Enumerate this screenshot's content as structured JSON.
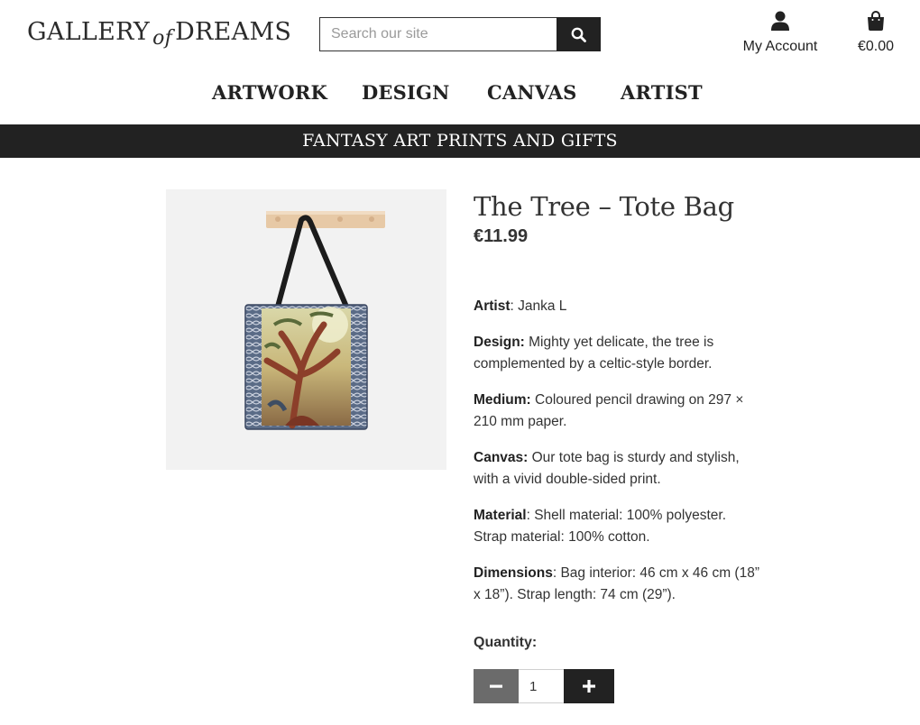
{
  "header": {
    "logo_part1": "GALLERY",
    "logo_of": "of",
    "logo_part2": "DREAMS",
    "search_placeholder": "Search our site",
    "search_icon": "search-icon",
    "account_label": "My Account",
    "account_icon": "user-icon",
    "cart_total": "€0.00",
    "cart_icon": "shopping-bag-icon"
  },
  "nav": {
    "items": [
      "ARTWORK",
      "DESIGN",
      "CANVAS",
      "ARTIST"
    ]
  },
  "banner": {
    "text": "FANTASY ART PRINTS AND GIFTS"
  },
  "product": {
    "title": "The Tree – Tote Bag",
    "price": "€11.99",
    "specs": [
      {
        "label": "Artist",
        "value": ": Janka L"
      },
      {
        "label": "Design:",
        "value": " Mighty yet delicate, the tree is complemented by a celtic-style border."
      },
      {
        "label": "Medium:",
        "value": " Coloured pencil drawing on 297 × 210 mm paper."
      },
      {
        "label": "Canvas:",
        "value": " Our tote bag is sturdy and stylish, with a vivid double-sided print."
      },
      {
        "label": "Material",
        "value": ": Shell material: 100% polyester. Strap material: 100% cotton."
      },
      {
        "label": "Dimensions",
        "value": ": Bag interior: 46 cm x 46 cm (18” x 18”). Strap length: 74 cm (29”)."
      }
    ],
    "quantity_label": "Quantity:",
    "quantity_value": "1"
  },
  "colors": {
    "dark": "#222222",
    "minus_button": "#6b6b6b",
    "image_background": "#f2f2f2"
  }
}
